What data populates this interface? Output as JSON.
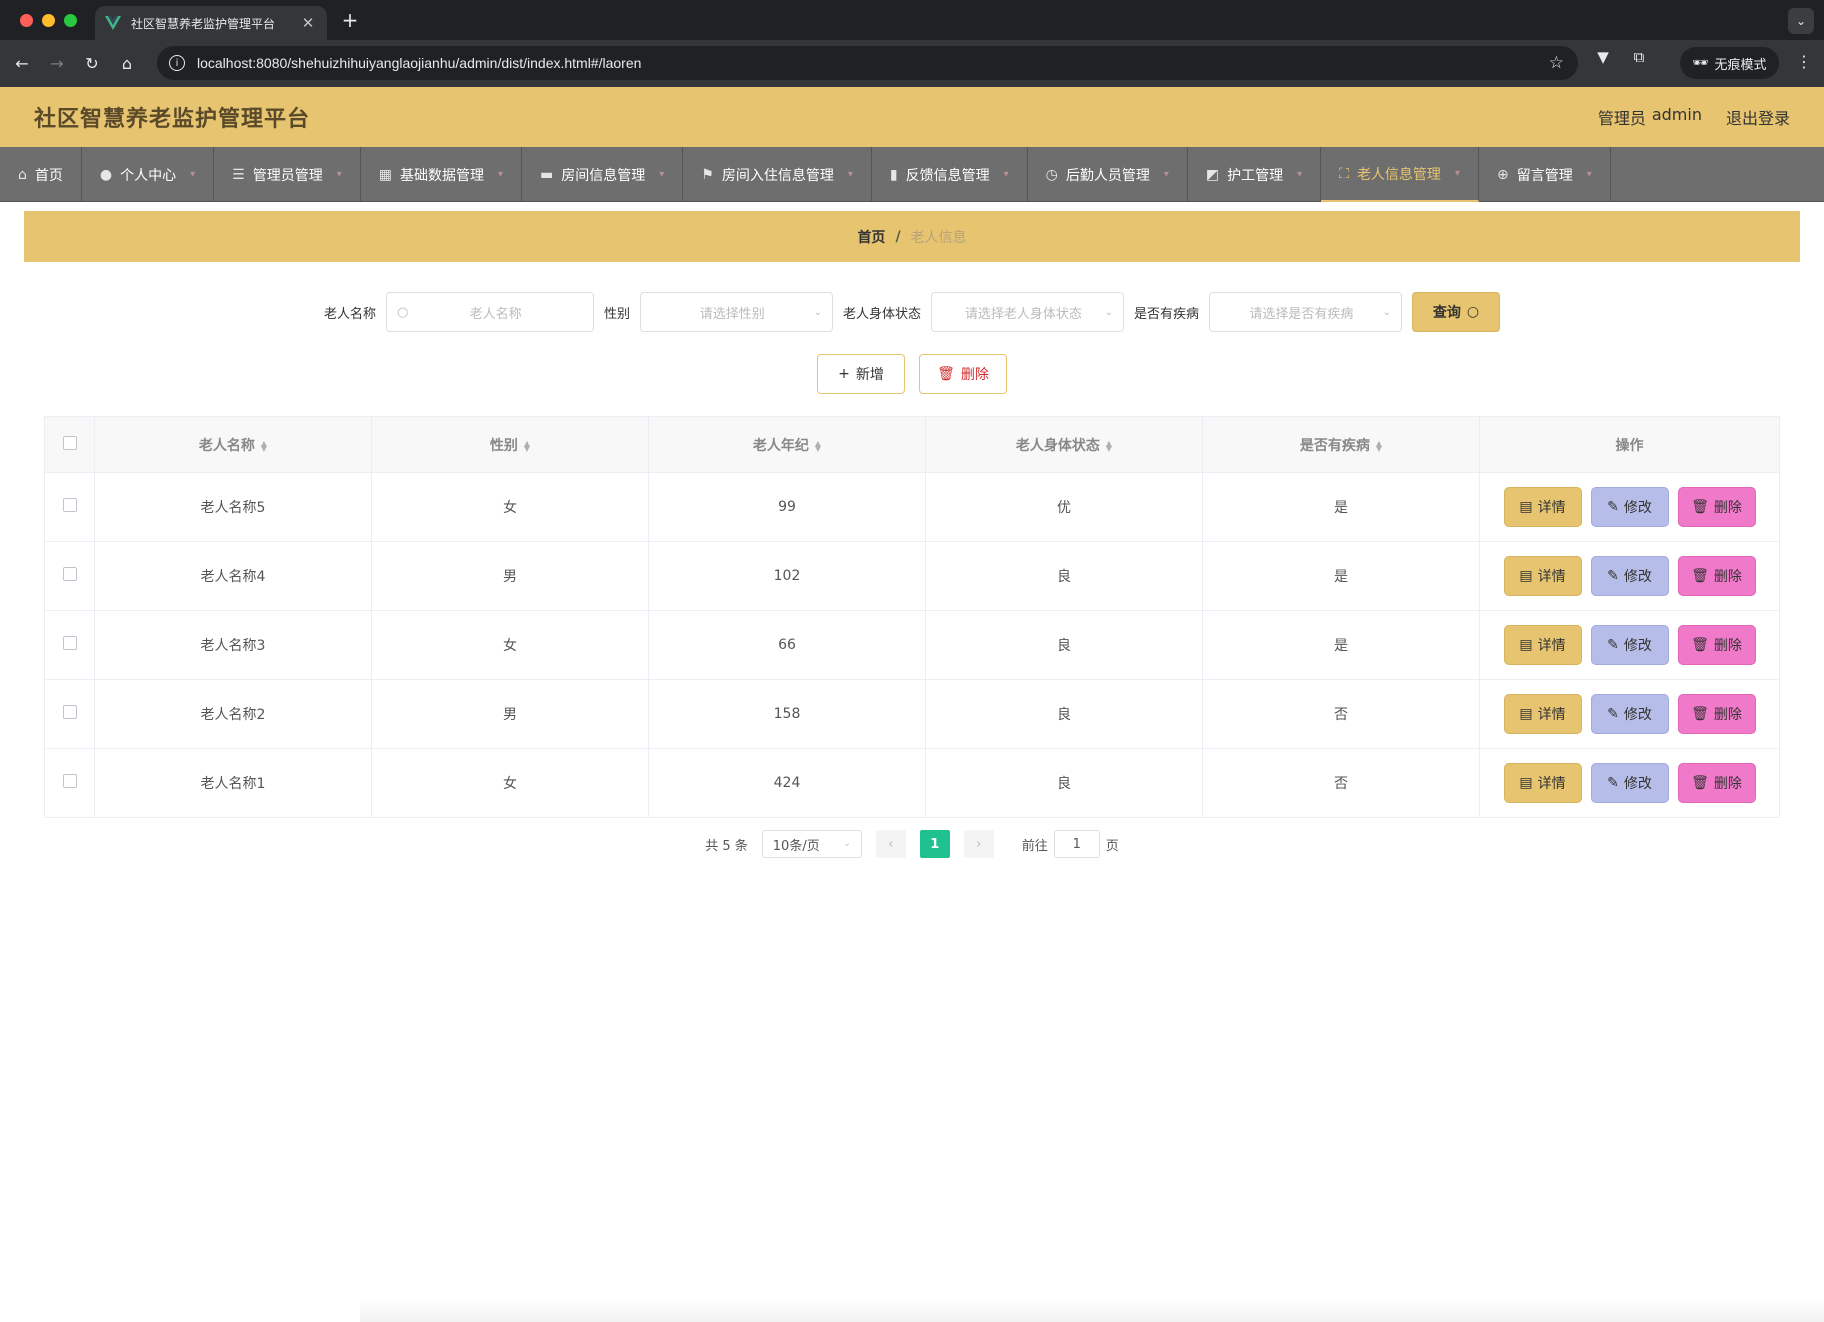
{
  "browser": {
    "tab_title": "社区智慧养老监护管理平台",
    "url": "localhost:8080/shehuizhihuiyanglaojianhu/admin/dist/index.html#/laoren",
    "incognito_label": "无痕模式"
  },
  "header": {
    "title": "社区智慧养老监护管理平台",
    "role": "管理员",
    "username": "admin",
    "logout": "退出登录"
  },
  "menu": [
    {
      "label": "首页",
      "icon": "home-icon"
    },
    {
      "label": "个人中心",
      "icon": "user-icon"
    },
    {
      "label": "管理员管理",
      "icon": "list-icon"
    },
    {
      "label": "基础数据管理",
      "icon": "grid-icon"
    },
    {
      "label": "房间信息管理",
      "icon": "room-icon"
    },
    {
      "label": "房间入住信息管理",
      "icon": "flag-icon"
    },
    {
      "label": "反馈信息管理",
      "icon": "chart-icon"
    },
    {
      "label": "后勤人员管理",
      "icon": "clock-icon"
    },
    {
      "label": "护工管理",
      "icon": "trend-icon"
    },
    {
      "label": "老人信息管理",
      "icon": "fullscreen-icon",
      "active": true
    },
    {
      "label": "留言管理",
      "icon": "compass-icon"
    }
  ],
  "breadcrumb": {
    "home": "首页",
    "separator": "/",
    "current": "老人信息"
  },
  "search": {
    "name_label": "老人名称",
    "name_placeholder": "老人名称",
    "gender_label": "性别",
    "gender_placeholder": "请选择性别",
    "status_label": "老人身体状态",
    "status_placeholder": "请选择老人身体状态",
    "disease_label": "是否有疾病",
    "disease_placeholder": "请选择是否有疾病",
    "query_button": "查询"
  },
  "actions": {
    "add": "新增",
    "delete": "删除"
  },
  "table": {
    "columns": [
      "老人名称",
      "性别",
      "老人年纪",
      "老人身体状态",
      "是否有疾病",
      "操作"
    ],
    "row_actions": {
      "detail": "详情",
      "edit": "修改",
      "delete": "删除"
    },
    "rows": [
      [
        "老人名称5",
        "女",
        "99",
        "优",
        "是"
      ],
      [
        "老人名称4",
        "男",
        "102",
        "良",
        "是"
      ],
      [
        "老人名称3",
        "女",
        "66",
        "良",
        "是"
      ],
      [
        "老人名称2",
        "男",
        "158",
        "良",
        "否"
      ],
      [
        "老人名称1",
        "女",
        "424",
        "良",
        "否"
      ]
    ]
  },
  "pagination": {
    "total_prefix": "共",
    "total": "5",
    "total_suffix": "条",
    "page_size": "10条/页",
    "current_page": "1",
    "goto_label": "前往",
    "goto_value": "1",
    "goto_suffix": "页"
  },
  "colors": {
    "accent": "#e7c46f",
    "menu_bg": "#6e6e6e",
    "page_active": "#1fc18f",
    "edit": "#b6bde9",
    "delete": "#f07ac9"
  }
}
